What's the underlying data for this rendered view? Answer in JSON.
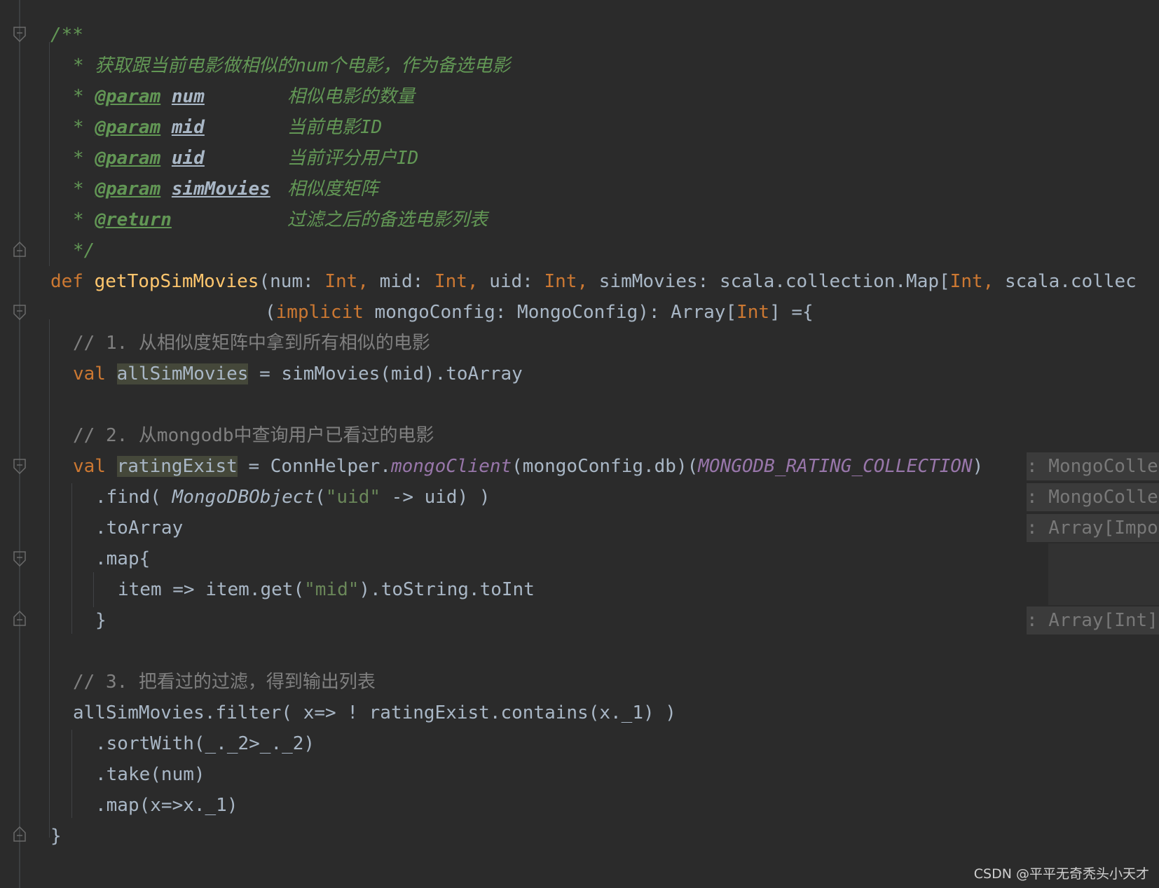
{
  "doc": {
    "open": "/**",
    "summary": "* 获取跟当前电影做相似的num个电影，作为备选电影",
    "star": "*",
    "param_tag": "@param",
    "return_tag": "@return",
    "params": [
      {
        "name": "num",
        "desc": "相似电影的数量"
      },
      {
        "name": "mid",
        "desc": "当前电影ID"
      },
      {
        "name": "uid",
        "desc": "当前评分用户ID"
      },
      {
        "name": "simMovies",
        "desc": "相似度矩阵"
      }
    ],
    "return_desc": "过滤之后的备选电影列表",
    "close": "*/"
  },
  "code": {
    "def_kw": "def",
    "fn_name": "getTopSimMovies",
    "sig1_a": "(num: ",
    "int": "Int",
    "comma": ", ",
    "sig1_b": "mid: ",
    "sig1_c": "uid: ",
    "sig1_d": "simMovies: scala.collection.Map[",
    "sig1_e": "scala.collec",
    "sig2_a": "(",
    "implicit_kw": "implicit",
    "sig2_b": " mongoConfig: MongoConfig): Array[",
    "sig2_c": "] ={",
    "c1": "// 1. 从相似度矩阵中拿到所有相似的电影",
    "val_kw": "val",
    "all_sim": "allSimMovies",
    "l1_rest": " = simMovies(mid).toArray",
    "c2": "// 2. 从mongodb中查询用户已看过的电影",
    "rating_exist": "ratingExist",
    "l2_a": " = ConnHelper.",
    "mongo_client": "mongoClient",
    "l2_b": "(mongoConfig.db)(",
    "rating_coll": "MONGODB_RATING_COLLECTION",
    "l2_c": ")",
    "find_a": ".find( ",
    "mongo_obj": "MongoDBObject",
    "paren_open": "(",
    "uid_str": "\"uid\"",
    "find_b": " -> uid) )",
    "to_array": ".toArray",
    "map_open": ".map{",
    "item_a": "item => item.get(",
    "mid_str": "\"mid\"",
    "item_b": ").toString.toInt",
    "brace_close": "}",
    "c3": "// 3. 把看过的过滤，得到输出列表",
    "filter_line": "allSimMovies.filter( x=> ! ratingExist.contains(x._1) )",
    "sort_line": ".sortWith(_._2>_._2)",
    "take_line": ".take(num)",
    "map_line": ".map(x=>x._1)",
    "end_brace": "}"
  },
  "hints": {
    "h1": ": MongoColle",
    "h2": ": MongoColle",
    "h3": ": Array[Impo",
    "h4": ": Array[Int]"
  },
  "watermark": "CSDN @平平无奇秃头小天才"
}
